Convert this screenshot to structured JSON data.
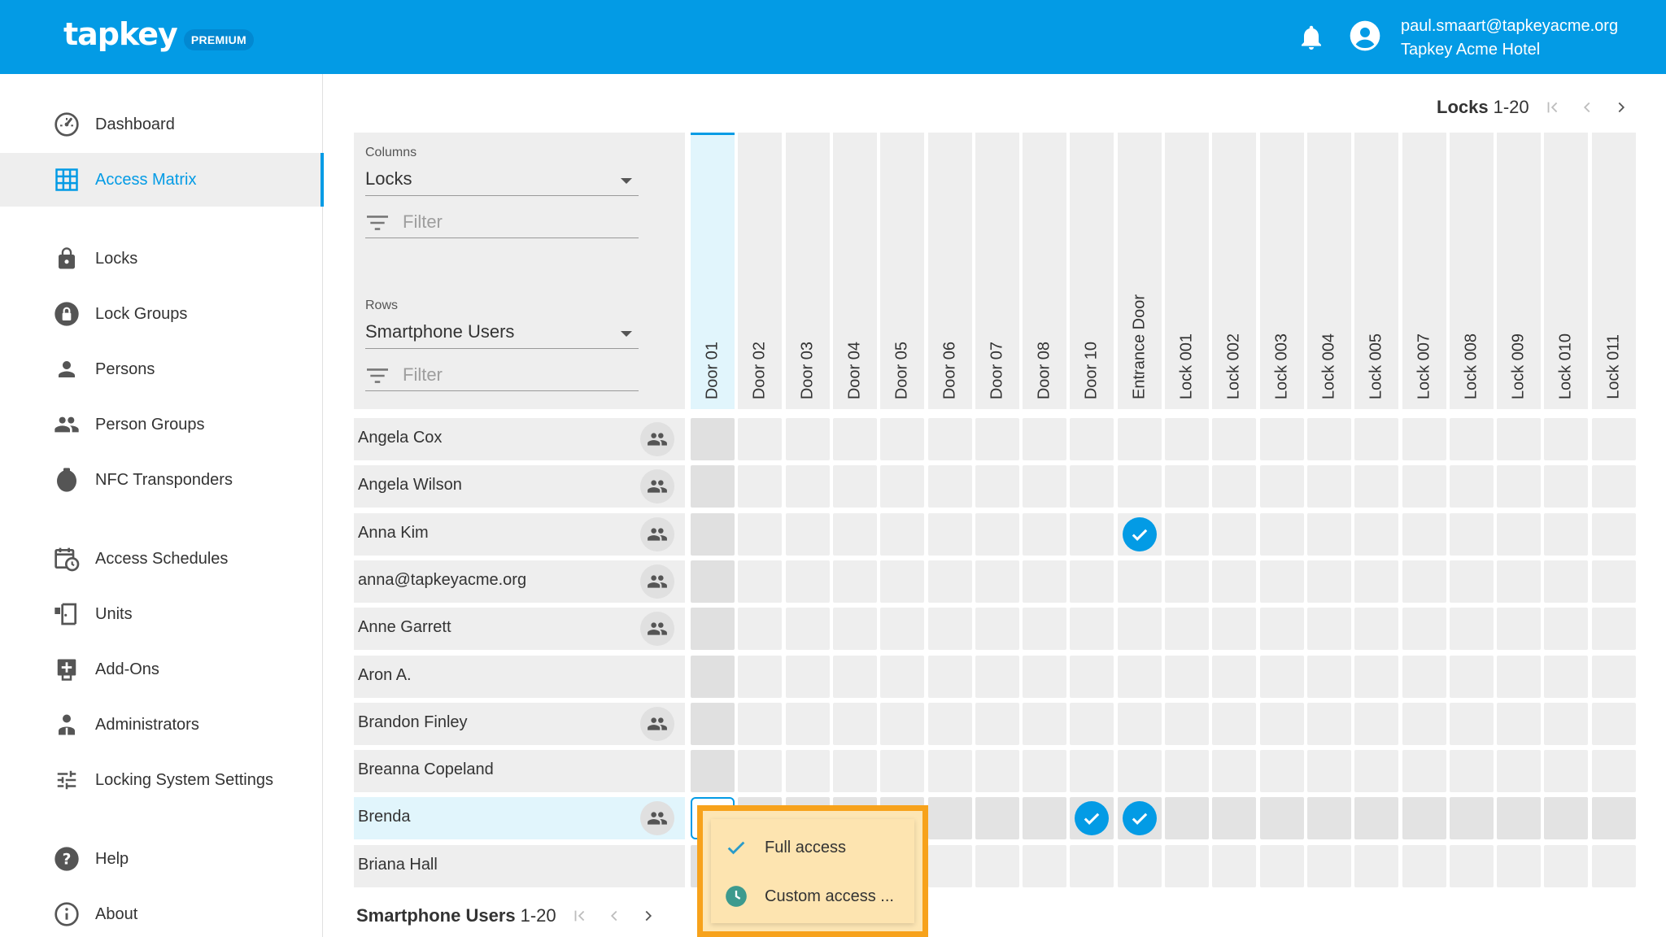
{
  "header": {
    "logo": "tapkey",
    "badge": "PREMIUM",
    "user_email": "paul.smaart@tapkeyacme.org",
    "organization": "Tapkey Acme Hotel"
  },
  "sidebar": {
    "items": [
      {
        "label": "Dashboard",
        "icon": "dashboard-icon"
      },
      {
        "label": "Access Matrix",
        "icon": "grid-icon",
        "active": true
      },
      {
        "label": "Locks",
        "icon": "lock-icon"
      },
      {
        "label": "Lock Groups",
        "icon": "lock-group-icon"
      },
      {
        "label": "Persons",
        "icon": "person-icon"
      },
      {
        "label": "Person Groups",
        "icon": "people-icon"
      },
      {
        "label": "NFC Transponders",
        "icon": "nfc-tag-icon"
      },
      {
        "label": "Access Schedules",
        "icon": "calendar-clock-icon"
      },
      {
        "label": "Units",
        "icon": "door-icon"
      },
      {
        "label": "Add-Ons",
        "icon": "add-box-icon"
      },
      {
        "label": "Administrators",
        "icon": "admin-icon"
      },
      {
        "label": "Locking System Settings",
        "icon": "tune-icon"
      },
      {
        "label": "Help",
        "icon": "help-icon"
      },
      {
        "label": "About",
        "icon": "info-icon"
      }
    ]
  },
  "columns_pager": {
    "label": "Locks",
    "range": "1-20"
  },
  "rows_pager": {
    "label": "Smartphone Users",
    "range": "1-20"
  },
  "controls": {
    "columns_label": "Columns",
    "columns_value": "Locks",
    "columns_filter_placeholder": "Filter",
    "rows_label": "Rows",
    "rows_value": "Smartphone Users",
    "rows_filter_placeholder": "Filter"
  },
  "columns": [
    "Door 01",
    "Door 02",
    "Door 03",
    "Door 04",
    "Door 05",
    "Door 06",
    "Door 07",
    "Door 08",
    "Door 10",
    "Entrance Door",
    "Lock 001",
    "Lock 002",
    "Lock 003",
    "Lock 004",
    "Lock 005",
    "Lock 007",
    "Lock 008",
    "Lock 009",
    "Lock 010",
    "Lock 011"
  ],
  "rows": [
    {
      "name": "Angela Cox",
      "has_group": true,
      "access": []
    },
    {
      "name": "Angela Wilson",
      "has_group": true,
      "access": []
    },
    {
      "name": "Anna Kim",
      "has_group": true,
      "access": [
        "Entrance Door"
      ]
    },
    {
      "name": "anna@tapkeyacme.org",
      "has_group": true,
      "access": []
    },
    {
      "name": "Anne Garrett",
      "has_group": true,
      "access": []
    },
    {
      "name": "Aron A.",
      "has_group": false,
      "access": []
    },
    {
      "name": "Brandon Finley",
      "has_group": true,
      "access": []
    },
    {
      "name": "Breanna Copeland",
      "has_group": false,
      "access": []
    },
    {
      "name": "Brenda",
      "has_group": true,
      "access": [
        "Door 10",
        "Entrance Door"
      ],
      "selected": true
    },
    {
      "name": "Briana Hall",
      "has_group": false,
      "access": []
    }
  ],
  "selected_cell": {
    "row": "Brenda",
    "column": "Door 01"
  },
  "menu": {
    "items": [
      {
        "label": "Full access",
        "icon": "check-icon"
      },
      {
        "label": "Custom access ...",
        "icon": "clock-icon"
      }
    ]
  },
  "colors": {
    "accent": "#039be5",
    "highlight": "#f7a21b",
    "menu_bg": "#fde4b0"
  }
}
